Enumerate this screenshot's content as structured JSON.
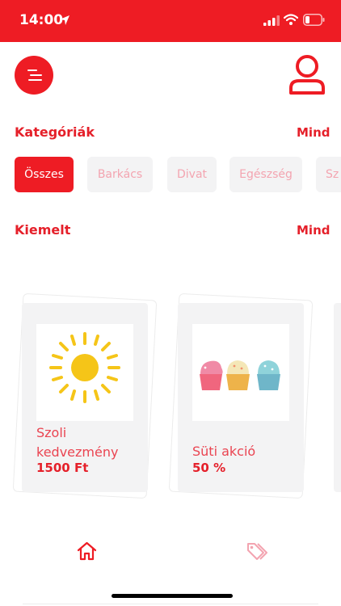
{
  "status_bar": {
    "time": "14:00",
    "icons": [
      "location-arrow-icon",
      "signal-icon",
      "wifi-icon",
      "battery-icon"
    ],
    "background": "#ee1c24"
  },
  "header": {
    "menu_icon": "menu-icon",
    "profile_icon": "user-profile-icon"
  },
  "categories": {
    "title": "Kategóriák",
    "more_label": "Mind",
    "items": [
      {
        "label": "Összes",
        "active": true
      },
      {
        "label": "Barkács",
        "active": false
      },
      {
        "label": "Divat",
        "active": false
      },
      {
        "label": "Egészség",
        "active": false
      },
      {
        "label": "Sz",
        "active": false
      }
    ]
  },
  "featured": {
    "title": "Kiemelt",
    "more_label": "Mind",
    "cards": [
      {
        "title": "Szoli kedvezmény",
        "value": "1500 Ft",
        "image": "sun-icon"
      },
      {
        "title": "Süti akció",
        "value": "50 %",
        "image": "cupcakes-image"
      }
    ]
  },
  "bottom_nav": {
    "items": [
      {
        "icon": "home-icon",
        "active": true
      },
      {
        "icon": "tag-icon",
        "active": false
      }
    ]
  },
  "colors": {
    "accent": "#ee1c24",
    "chip_bg": "#f3f3f4",
    "chip_text": "#f3a4b0",
    "card_bg": "#f3f3f4"
  }
}
